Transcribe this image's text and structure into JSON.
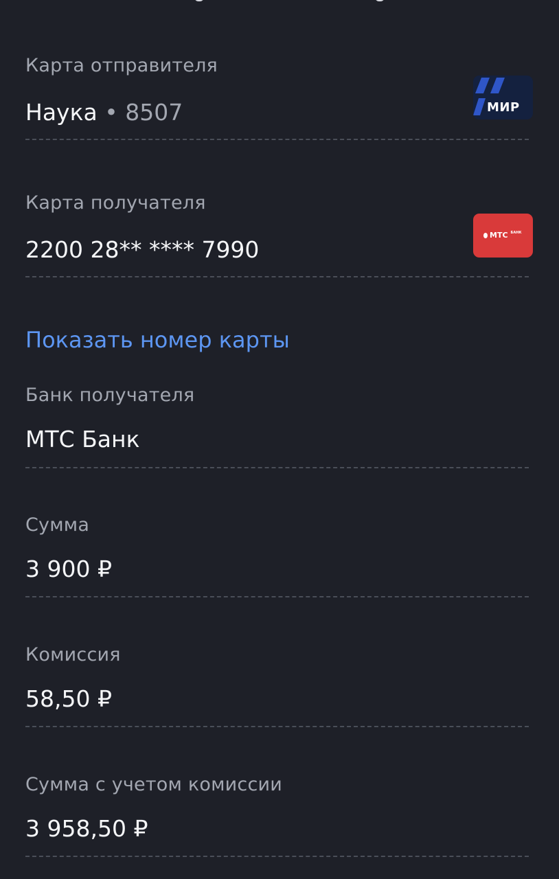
{
  "sender_card": {
    "label": "Карта отправителя",
    "name": "Наука",
    "separator": "•",
    "last_digits": "8507",
    "payment_system": "МИР",
    "payment_system_icon": "mir-logo"
  },
  "recipient_card": {
    "label": "Карта получателя",
    "number": "2200 28** **** 7990",
    "bank_logo_text": "МТС",
    "bank_logo_sub": "БАНК",
    "bank_logo_color": "#d93a3a"
  },
  "show_card_number_link": "Показать номер карты",
  "recipient_bank": {
    "label": "Банк получателя",
    "value": "МТС Банк"
  },
  "amount": {
    "label": "Сумма",
    "value": "3 900 ₽"
  },
  "fee": {
    "label": "Комиссия",
    "value": "58,50 ₽"
  },
  "total": {
    "label": "Сумма с учетом комиссии",
    "value": "3 958,50 ₽"
  },
  "colors": {
    "background": "#1e2028",
    "label": "#a3a7b1",
    "value": "#f5f6f8",
    "link": "#5d96f2",
    "mir_badge": "#14213f",
    "mts_badge": "#d93a3a"
  }
}
